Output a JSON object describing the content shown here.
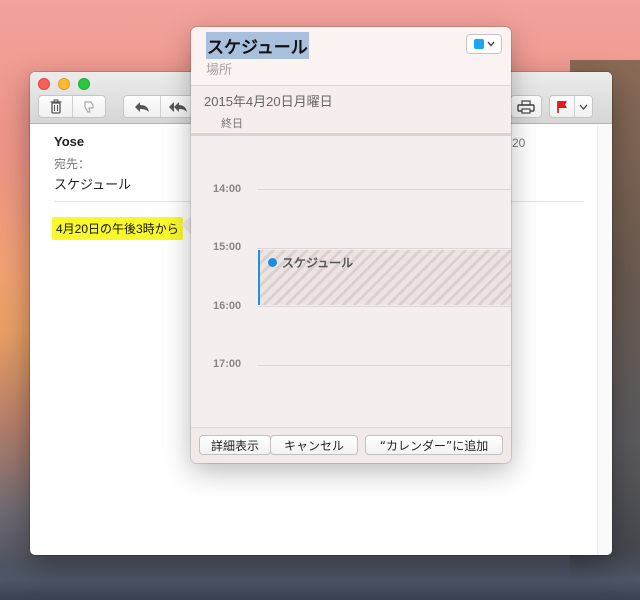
{
  "mail": {
    "sender": "Yose",
    "to_label": "宛先：",
    "subject": "スケジュール",
    "date_fragment": "20",
    "highlighted_text": "4月20日の午後3時から"
  },
  "popover": {
    "title": "スケジュール",
    "location_placeholder": "場所",
    "date": "2015年4月20日月曜日",
    "all_day": "終日",
    "calendar_color": "#1ea5f0",
    "hours": [
      "14:00",
      "15:00",
      "16:00",
      "17:00"
    ],
    "event_name": "スケジュール",
    "buttons": {
      "details": "詳細表示",
      "cancel": "キャンセル",
      "add": "“カレンダー”に追加"
    }
  },
  "toolbar": {
    "icons": [
      "trash-icon",
      "junk-icon",
      "reply-icon",
      "reply-all-icon",
      "print-icon",
      "flag-icon",
      "flag-menu-chevron-icon"
    ]
  }
}
